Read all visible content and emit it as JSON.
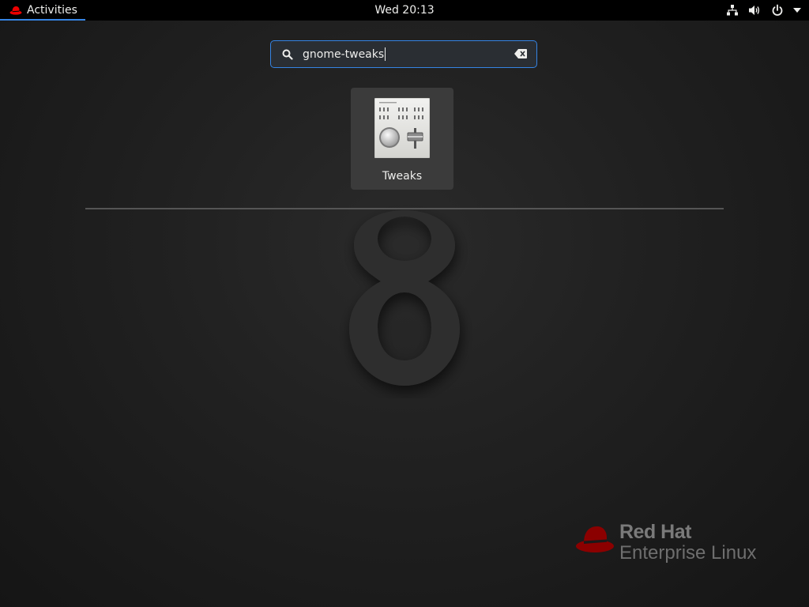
{
  "topbar": {
    "activities_label": "Activities",
    "clock": "Wed 20:13",
    "status_icons": [
      "network-icon",
      "volume-icon",
      "power-icon",
      "dropdown-arrow-icon"
    ]
  },
  "search": {
    "value": "gnome-tweaks",
    "icons": {
      "search": "search-icon",
      "clear": "clear-text-icon"
    }
  },
  "results": [
    {
      "label": "Tweaks",
      "icon": "tweaks-app-icon"
    }
  ],
  "wallpaper": {
    "numeral": "8",
    "brand_line1": "Red Hat",
    "brand_line2": "Enterprise Linux"
  },
  "colors": {
    "accent": "#3584e4",
    "topbar": "#000000",
    "redhat_red": "#c00000"
  }
}
